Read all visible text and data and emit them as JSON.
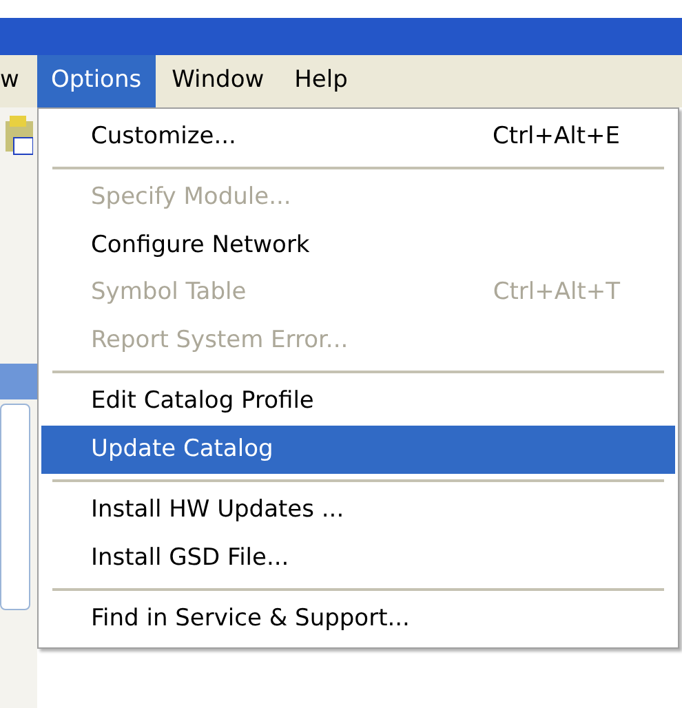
{
  "menu_bar": [
    {
      "label": "w",
      "selected": false
    },
    {
      "label": "Options",
      "selected": true
    },
    {
      "label": "Window",
      "selected": false
    },
    {
      "label": "Help",
      "selected": false
    }
  ],
  "options_menu": [
    {
      "kind": "item",
      "label": "Customize...",
      "shortcut": "Ctrl+Alt+E",
      "disabled": false,
      "selected": false
    },
    {
      "kind": "separator"
    },
    {
      "kind": "item",
      "label": "Specify Module...",
      "disabled": true,
      "selected": false
    },
    {
      "kind": "item",
      "label": "Configure Network",
      "disabled": false,
      "selected": false
    },
    {
      "kind": "item",
      "label": "Symbol Table",
      "shortcut": "Ctrl+Alt+T",
      "disabled": true,
      "selected": false
    },
    {
      "kind": "item",
      "label": "Report System Error...",
      "disabled": true,
      "selected": false
    },
    {
      "kind": "separator"
    },
    {
      "kind": "item",
      "label": "Edit Catalog Profile",
      "disabled": false,
      "selected": false
    },
    {
      "kind": "item",
      "label": "Update Catalog",
      "disabled": false,
      "selected": true
    },
    {
      "kind": "separator"
    },
    {
      "kind": "item",
      "label": "Install HW Updates ...",
      "disabled": false,
      "selected": false
    },
    {
      "kind": "item",
      "label": "Install GSD File...",
      "disabled": false,
      "selected": false
    },
    {
      "kind": "separator"
    },
    {
      "kind": "item",
      "label": "Find in Service & Support...",
      "disabled": false,
      "selected": false
    }
  ]
}
